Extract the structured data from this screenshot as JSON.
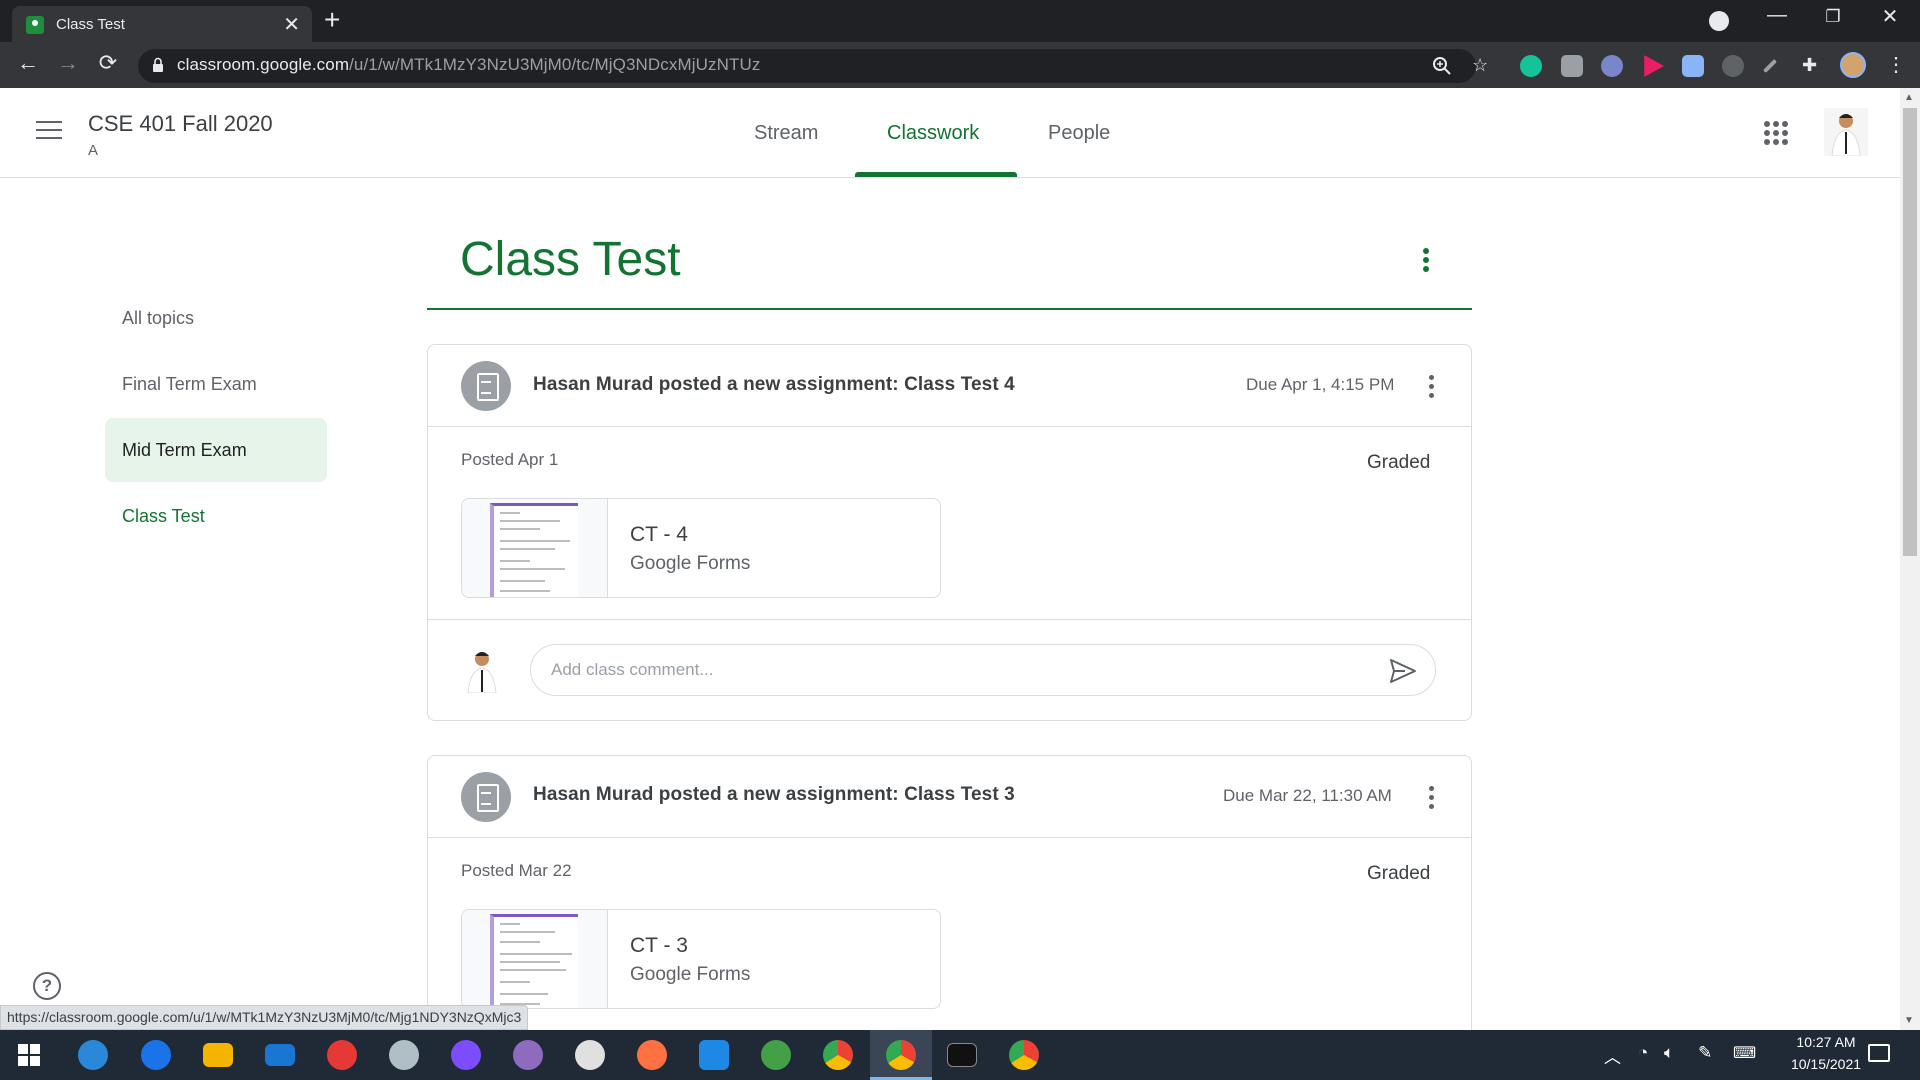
{
  "browser": {
    "tab_title": "Class Test",
    "tab_close": "✕",
    "new_tab": "+",
    "url_host": "classroom.google.com",
    "url_path": "/u/1/w/MTk1MzY3NzU3MjM0/tc/MjQ3NDcxMjUzNTUz",
    "status_url": "https://classroom.google.com/u/1/w/MTk1MzY3NzU3MjM0/tc/Mjg1NDY3NzQxMjc3"
  },
  "header": {
    "class_name": "CSE 401 Fall 2020",
    "section": "A",
    "tabs": [
      {
        "label": "Stream"
      },
      {
        "label": "Classwork"
      },
      {
        "label": "People"
      }
    ]
  },
  "sidebar": {
    "topics": [
      {
        "label": "All topics"
      },
      {
        "label": "Final Term Exam"
      },
      {
        "label": "Mid Term Exam"
      },
      {
        "label": "Class Test"
      }
    ]
  },
  "topic_heading": "Class Test",
  "assignments": [
    {
      "title": "Hasan Murad posted a new assignment: Class Test 4",
      "due": "Due Apr 1, 4:15 PM",
      "posted": "Posted Apr 1",
      "status": "Graded",
      "attachment": {
        "title": "CT - 4",
        "type": "Google Forms"
      },
      "comment_placeholder": "Add class comment..."
    },
    {
      "title": "Hasan Murad posted a new assignment: Class Test 3",
      "due": "Due Mar 22, 11:30 AM",
      "posted": "Posted Mar 22",
      "status": "Graded",
      "attachment": {
        "title": "CT - 3",
        "type": "Google Forms"
      }
    }
  ],
  "help_label": "?",
  "taskbar": {
    "time": "10:27 AM",
    "date": "10/15/2021"
  },
  "colors": {
    "accent": "#137333",
    "topic_highlight": "#e6f4ea",
    "chrome_dark": "#202124",
    "taskbar": "#1f2a36"
  }
}
